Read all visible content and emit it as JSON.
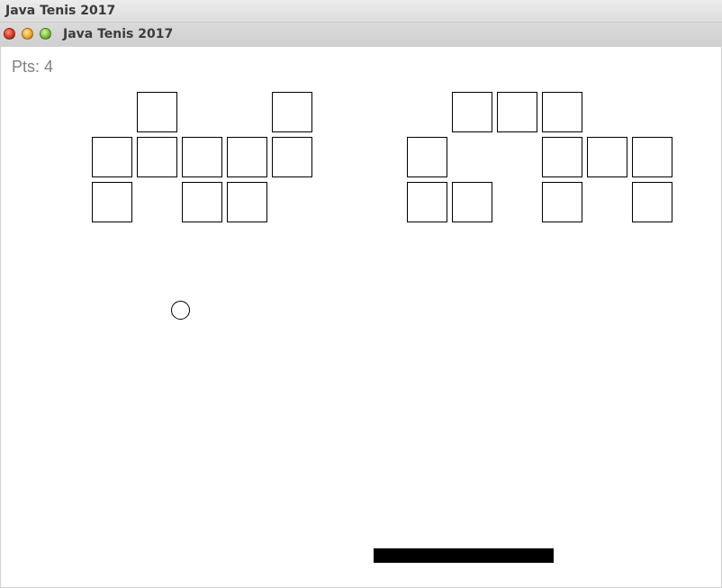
{
  "app": {
    "header_title": "Java Tenis 2017",
    "window_title": "Java Tenis 2017"
  },
  "game": {
    "score_text": "Pts: 4",
    "brick_columns": 14,
    "brick_rows": 3,
    "bricks": [
      [
        0,
        1,
        0,
        0,
        1,
        0,
        0,
        0,
        1,
        1,
        1,
        0,
        0,
        0
      ],
      [
        1,
        1,
        1,
        1,
        1,
        0,
        0,
        1,
        0,
        0,
        1,
        1,
        1,
        0
      ],
      [
        1,
        0,
        1,
        1,
        0,
        0,
        0,
        1,
        1,
        0,
        1,
        0,
        1,
        0
      ]
    ]
  },
  "colors": {
    "background": "#ffffff",
    "brick_border": "#000000",
    "paddle": "#000000",
    "score_text": "#808080"
  }
}
